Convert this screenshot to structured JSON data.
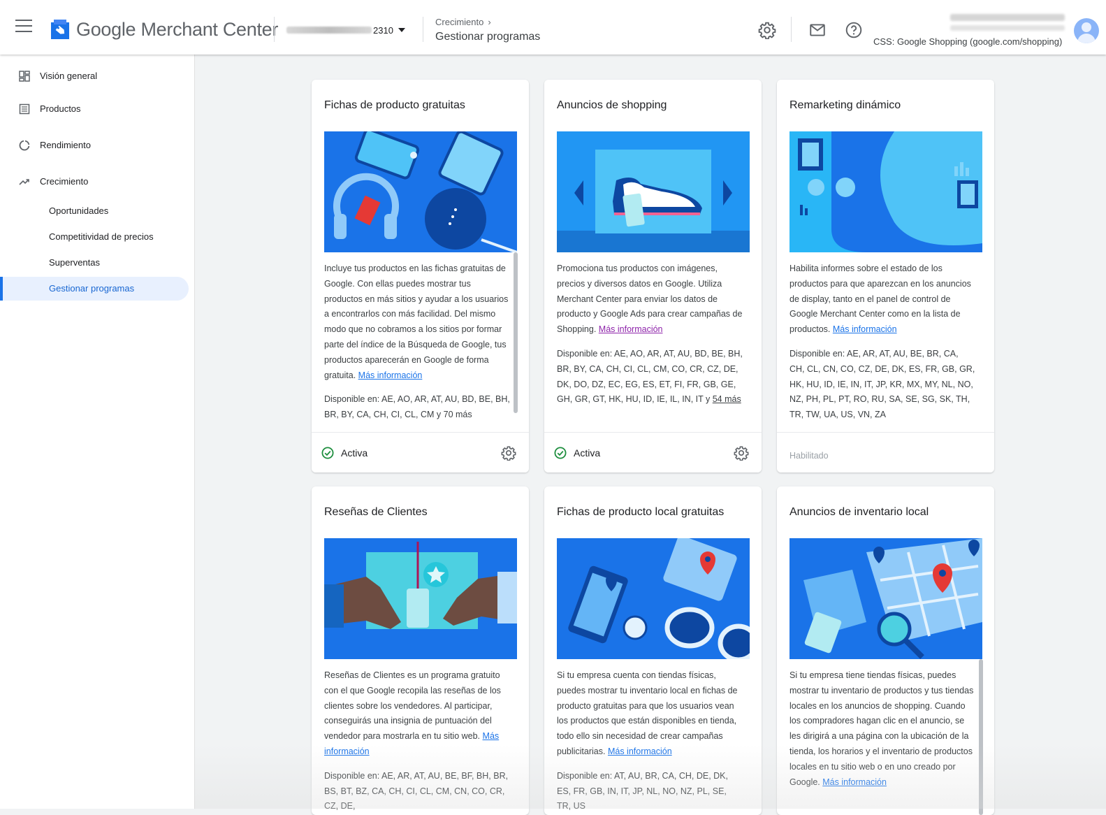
{
  "header": {
    "app_name": "Google Merchant Center",
    "account_id": "2310",
    "breadcrumb_parent": "Crecimiento",
    "page_title": "Gestionar programas",
    "css_label": "CSS: Google Shopping (google.com/shopping)",
    "icons": [
      "menu-icon",
      "gear-icon",
      "mail-icon",
      "help-icon",
      "avatar"
    ]
  },
  "sidebar": {
    "items": [
      {
        "label": "Visión general",
        "icon": "dashboard-icon"
      },
      {
        "label": "Productos",
        "icon": "list-icon"
      },
      {
        "label": "Rendimiento",
        "icon": "circle-chart-icon"
      },
      {
        "label": "Crecimiento",
        "icon": "trending-up-icon"
      }
    ],
    "subitems": [
      {
        "label": "Oportunidades"
      },
      {
        "label": "Competitividad de precios"
      },
      {
        "label": "Superventas"
      },
      {
        "label": "Gestionar programas",
        "active": true
      }
    ]
  },
  "programs": [
    {
      "title": "Fichas de producto gratuitas",
      "description": "Incluye tus productos en las fichas gratuitas de Google. Con ellas puedes mostrar tus productos en más sitios y ayudar a los usuarios a encontrarlos con más facilidad. Del mismo modo que no cobramos a los sitios por formar parte del índice de la Búsqueda de Google, tus productos aparecerán en Google de forma gratuita.",
      "link": "Más información",
      "availability": "Disponible en: AE, AO, AR, AT, AU, BD, BE, BH, BR, BY, CA, CH, CI, CL, CM y 70 más",
      "status": "Activa"
    },
    {
      "title": "Anuncios de shopping",
      "description": "Promociona tus productos con imágenes, precios y diversos datos en Google. Utiliza Merchant Center para enviar los datos de producto y Google Ads para crear campañas de Shopping.",
      "link": "Más información",
      "availability": "Disponible en: AE, AO, AR, AT, AU, BD, BE, BH, BR, BY, CA, CH, CI, CL, CM, CO, CR, CZ, DE, DK, DO, DZ, EC, EG, ES, ET, FI, FR, GB, GE, GH, GR, GT, HK, HU, ID, IE, IL, IN, IT y",
      "more": "54 más",
      "status": "Activa"
    },
    {
      "title": "Remarketing dinámico",
      "description": "Habilita informes sobre el estado de los productos para que aparezcan en los anuncios de display, tanto en el panel de control de Google Merchant Center como en la lista de productos.",
      "link": "Más información",
      "availability": "Disponible en: AE, AR, AT, AU, BE, BR, CA, CH, CL, CN, CO, CZ, DE, DK, ES, FR, GB, GR, HK, HU, ID, IE, IN, IT, JP, KR, MX, MY, NL, NO, NZ, PH, PL, PT, RO, RU, SA, SE, SG, SK, TH, TR, TW, UA, US, VN, ZA",
      "status": "Habilitado"
    },
    {
      "title": "Reseñas de Clientes",
      "description": "Reseñas de Clientes es un programa gratuito con el que Google recopila las reseñas de los clientes sobre los vendedores. Al participar, conseguirás una insignia de puntuación del vendedor para mostrarla en tu sitio web.",
      "link": "Más información",
      "availability": "Disponible en: AE, AR, AT, AU, BE, BF, BH, BR, BS, BT, BZ, CA, CH, CI, CL, CM, CN, CO, CR, CZ, DE,"
    },
    {
      "title": "Fichas de producto local gratuitas",
      "description": "Si tu empresa cuenta con tiendas físicas, puedes mostrar tu inventario local en fichas de producto gratuitas para que los usuarios vean los productos que están disponibles en tienda, todo ello sin necesidad de crear campañas publicitarias.",
      "link": "Más información",
      "availability": "Disponible en: AT, AU, BR, CA, CH, DE, DK, ES, FR, GB, IN, IT, JP, NL, NO, NZ, PL, SE, TR, US"
    },
    {
      "title": "Anuncios de inventario local",
      "description": "Si tu empresa tiene tiendas físicas, puedes mostrar tu inventario de productos y tus tiendas locales en los anuncios de shopping. Cuando los compradores hagan clic en el anuncio, se les dirigirá a una página con la ubicación de la tienda, los horarios y el inventario de productos locales en tu sitio web o en uno creado por Google.",
      "link": "Más información"
    }
  ]
}
